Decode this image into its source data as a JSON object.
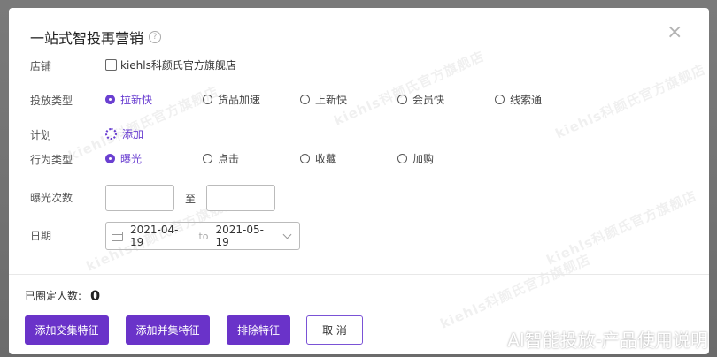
{
  "dialog": {
    "title": "一站式智投再营销",
    "close_glyph": "×"
  },
  "store": {
    "label": "店铺",
    "option": "kiehls科颜氏官方旗舰店"
  },
  "placement": {
    "label": "投放类型",
    "options": [
      "拉新快",
      "货品加速",
      "上新快",
      "会员快",
      "线索通"
    ],
    "selected": "拉新快"
  },
  "plan": {
    "label": "计划",
    "add_label": "添加"
  },
  "behavior": {
    "label": "行为类型",
    "options": [
      "曝光",
      "点击",
      "收藏",
      "加购"
    ],
    "selected": "曝光"
  },
  "exposure": {
    "label": "曝光次数",
    "from_value": "",
    "to_value": "",
    "separator": "至"
  },
  "date": {
    "label": "日期",
    "start": "2021-04-19",
    "separator": "to",
    "end": "2021-05-19"
  },
  "footer": {
    "count_label": "已圈定人数:",
    "count_value": "0",
    "btn_intersection": "添加交集特征",
    "btn_union": "添加并集特征",
    "btn_exclude": "排除特征",
    "btn_cancel": "取 消"
  },
  "watermark_text": "kiehls科颜氏官方旗舰店",
  "caption": "AI智能投放-产品使用说明",
  "colors": {
    "accent": "#6a33c9",
    "selected_text": "#6a3fd1"
  }
}
